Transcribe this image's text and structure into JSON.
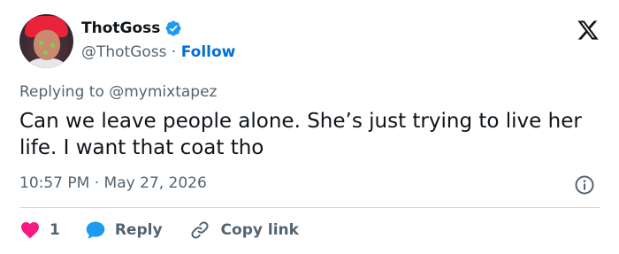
{
  "author": {
    "display_name": "ThotGoss",
    "handle": "@ThotGoss",
    "separator": "·",
    "follow_label": "Follow",
    "verified": true
  },
  "reply": {
    "prefix": "Replying to",
    "handle": "@mymixtapez"
  },
  "tweet": {
    "text": "Can we leave people alone. She’s just trying to live her life. I want that coat tho"
  },
  "meta": {
    "time": "10:57 PM",
    "separator": "·",
    "date": "May 27, 2026"
  },
  "actions": {
    "like_count": "1",
    "reply_label": "Reply",
    "copy_label": "Copy link"
  },
  "colors": {
    "accent": "#1d9bf0",
    "follow": "#006fd6",
    "like": "#f91880",
    "secondary_text": "#536471",
    "primary_text": "#0f1419",
    "divider": "#cfd9de"
  },
  "icons": {
    "verified": "verified-badge-icon",
    "logo": "x-logo-icon",
    "info": "info-icon",
    "like": "heart-icon",
    "reply": "speech-bubble-icon",
    "copy": "link-icon"
  }
}
